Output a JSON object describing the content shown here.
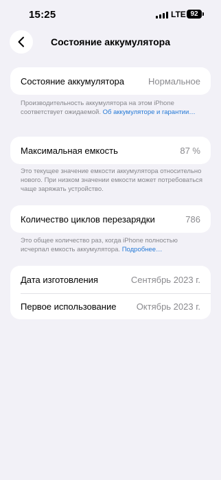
{
  "status_bar": {
    "time": "15:25",
    "network": "LTE",
    "battery_level": "92"
  },
  "nav": {
    "title": "Состояние аккумулятора"
  },
  "battery_condition": {
    "label": "Состояние аккумулятора",
    "value": "Нормальное",
    "footnote": "Производительность аккумулятора на этом iPhone соответствует ожидаемой.",
    "footnote_link": "Об аккумуляторе и гарантии…"
  },
  "max_capacity": {
    "label": "Максимальная емкость",
    "value": "87 %",
    "footnote": "Это текущее значение емкости аккумулятора относительно нового. При низком значении емкости может потребоваться чаще заряжать устройство."
  },
  "cycle_count": {
    "label": "Количество циклов перезарядки",
    "value": "786",
    "footnote": "Это общее количество раз, когда iPhone полностью исчерпал емкость аккумулятора.",
    "footnote_link": "Подробнее…"
  },
  "dates": {
    "manufacture_label": "Дата изготовления",
    "manufacture_value": "Сентябрь 2023 г.",
    "first_use_label": "Первое использование",
    "first_use_value": "Октябрь 2023 г."
  },
  "colors": {
    "background": "#f2f1f7",
    "card": "#ffffff",
    "link": "#2479d6",
    "secondary_text": "#8a8a8e"
  }
}
